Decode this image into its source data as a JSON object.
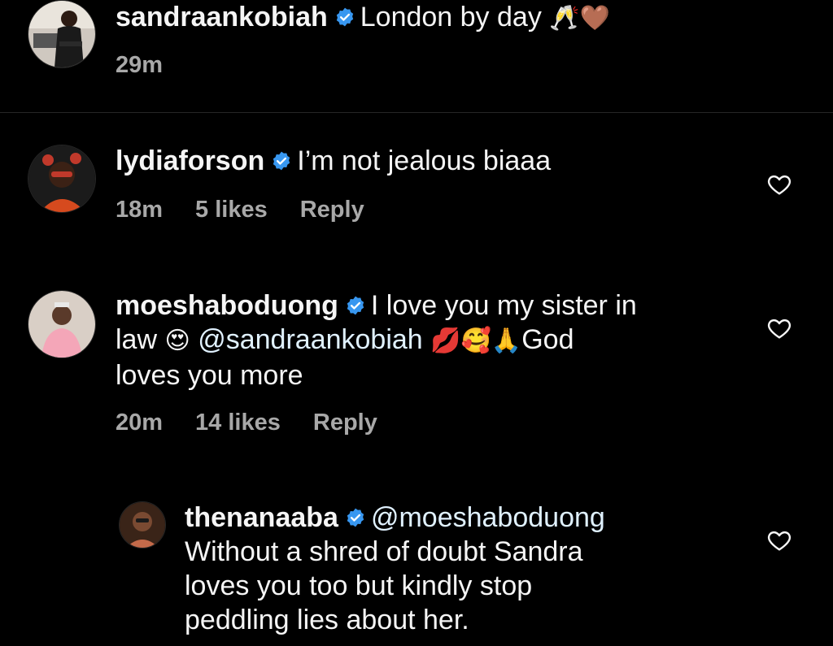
{
  "caption": {
    "username": "sandraankobiah",
    "text": "London by day",
    "emojis": "🥂🤎",
    "time": "29m"
  },
  "comments": [
    {
      "username": "lydiaforson",
      "text": "I’m not jealous biaaa",
      "time": "18m",
      "likes": "5 likes",
      "reply": "Reply"
    },
    {
      "username": "moeshaboduong",
      "text_line1": "I love you my sister in",
      "text_line2_a": "law",
      "emoji_a": "😍",
      "mention": "@sandraankobiah",
      "emoji_b": "💋🥰🙏",
      "text_line2_b": "God",
      "text_line3": "loves you more",
      "time": "20m",
      "likes": "14 likes",
      "reply": "Reply"
    },
    {
      "username": "thenanaaba",
      "mention": "@moeshaboduong",
      "text_line2": "Without a shred of doubt Sandra",
      "text_line3": "loves you too but kindly stop",
      "text_line4": "peddling lies about her."
    }
  ],
  "colors": {
    "background": "#000000",
    "text": "#f5f5f5",
    "meta": "#a8a8a8",
    "verified": "#3897f0"
  },
  "icons": [
    "verified-badge-icon",
    "heart-icon"
  ]
}
